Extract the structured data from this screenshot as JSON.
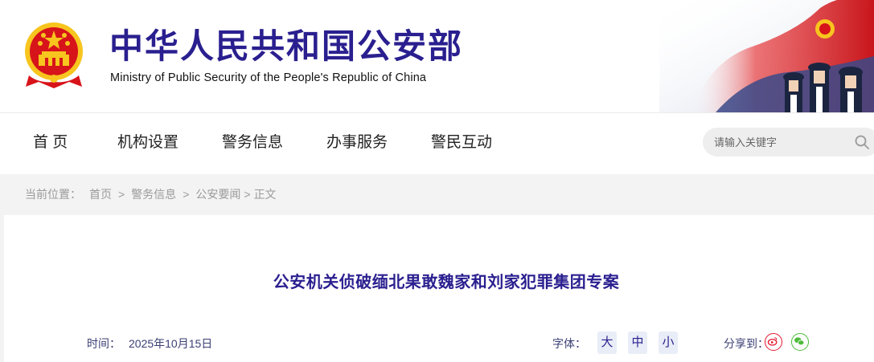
{
  "header": {
    "title_cn": "中华人民共和国公安部",
    "title_en": "Ministry of Public Security of the People's Republic of China"
  },
  "nav": {
    "items": [
      {
        "label": "首  页"
      },
      {
        "label": "机构设置"
      },
      {
        "label": "警务信息"
      },
      {
        "label": "办事服务"
      },
      {
        "label": "警民互动"
      }
    ],
    "search": {
      "placeholder": "请输入关键字",
      "icon": "search-icon"
    }
  },
  "breadcrumb": {
    "prefix": "当前位置：",
    "items": [
      "首页",
      "警务信息",
      "公安要闻",
      "正文"
    ],
    "separator": ">"
  },
  "article": {
    "title": "公安机关侦破缅北果敢魏家和刘家犯罪集团专案",
    "time_label": "时间：",
    "time_value": "2025年10月15日",
    "font_label": "字体：",
    "font_sizes": [
      "大",
      "中",
      "小"
    ],
    "share_label": "分享到：",
    "share_targets": [
      "weibo-icon",
      "wechat-icon"
    ]
  },
  "colors": {
    "brand_blue": "#2a1f8f",
    "emblem_red": "#d7141a",
    "emblem_gold": "#f7c51e",
    "weibo": "#e6162d",
    "wechat": "#4cbb3a"
  }
}
